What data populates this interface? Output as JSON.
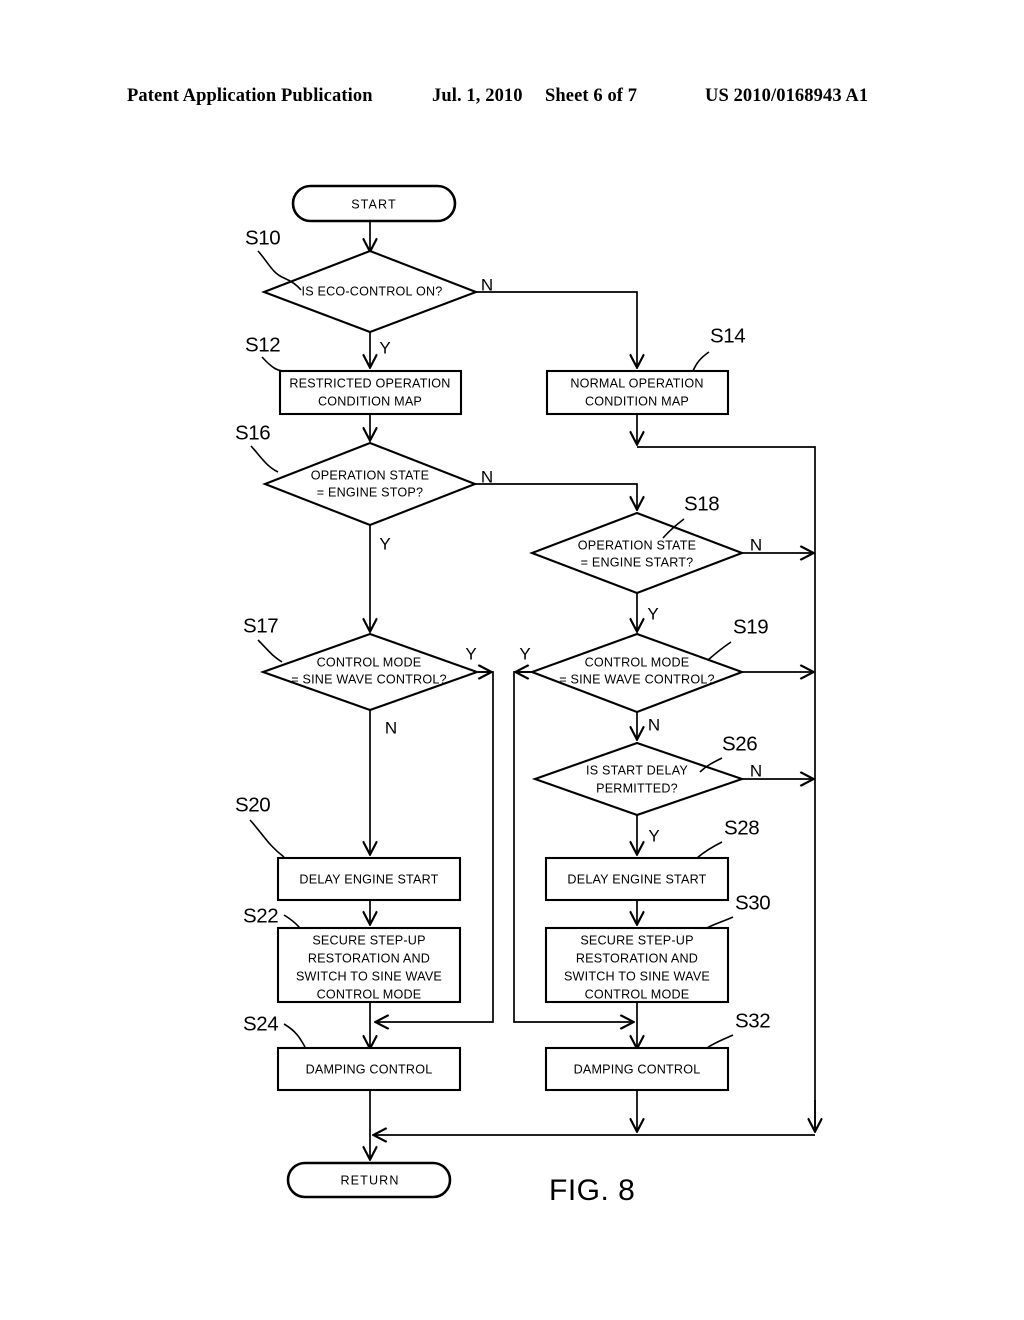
{
  "header": {
    "title": "Patent Application Publication",
    "date": "Jul. 1, 2010",
    "sheet": "Sheet 6 of 7",
    "number": "US 2010/0168943 A1"
  },
  "figure": {
    "caption": "FIG. 8"
  },
  "flowchart": {
    "terminals": {
      "start": "START",
      "return": "RETURN"
    },
    "branch_labels": {
      "yes": "Y",
      "no": "N"
    },
    "nodes": [
      {
        "id": "S10",
        "step": "S10",
        "type": "decision",
        "lines": [
          "IS ECO-CONTROL ON?"
        ]
      },
      {
        "id": "S12",
        "step": "S12",
        "type": "process",
        "lines": [
          "RESTRICTED OPERATION",
          "CONDITION MAP"
        ]
      },
      {
        "id": "S14",
        "step": "S14",
        "type": "process",
        "lines": [
          "NORMAL OPERATION",
          "CONDITION MAP"
        ]
      },
      {
        "id": "S16",
        "step": "S16",
        "type": "decision",
        "lines": [
          "OPERATION STATE",
          "= ENGINE STOP?"
        ]
      },
      {
        "id": "S18",
        "step": "S18",
        "type": "decision",
        "lines": [
          "OPERATION STATE",
          "= ENGINE START?"
        ]
      },
      {
        "id": "S17",
        "step": "S17",
        "type": "decision",
        "lines": [
          "CONTROL MODE",
          "= SINE WAVE CONTROL?"
        ]
      },
      {
        "id": "S19",
        "step": "S19",
        "type": "decision",
        "lines": [
          "CONTROL MODE",
          "= SINE WAVE CONTROL?"
        ]
      },
      {
        "id": "S26",
        "step": "S26",
        "type": "decision",
        "lines": [
          "IS START DELAY",
          "PERMITTED?"
        ]
      },
      {
        "id": "S20",
        "step": "S20",
        "type": "process",
        "lines": [
          "DELAY ENGINE START"
        ]
      },
      {
        "id": "S28",
        "step": "S28",
        "type": "process",
        "lines": [
          "DELAY ENGINE START"
        ]
      },
      {
        "id": "S22",
        "step": "S22",
        "type": "process",
        "lines": [
          "SECURE STEP-UP",
          "RESTORATION AND",
          "SWITCH TO SINE WAVE",
          "CONTROL MODE"
        ]
      },
      {
        "id": "S30",
        "step": "S30",
        "type": "process",
        "lines": [
          "SECURE STEP-UP",
          "RESTORATION AND",
          "SWITCH TO SINE WAVE",
          "CONTROL MODE"
        ]
      },
      {
        "id": "S24",
        "step": "S24",
        "type": "process",
        "lines": [
          "DAMPING CONTROL"
        ]
      },
      {
        "id": "S32",
        "step": "S32",
        "type": "process",
        "lines": [
          "DAMPING CONTROL"
        ]
      }
    ]
  },
  "colors": {
    "ink": "#000000",
    "paper": "#ffffff"
  }
}
